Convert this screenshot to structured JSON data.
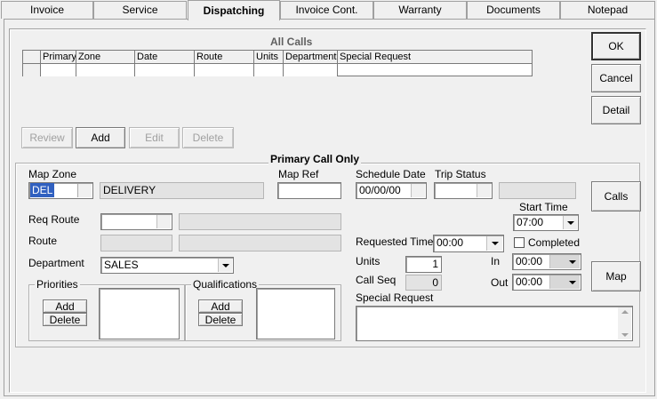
{
  "tabs": [
    "Invoice",
    "Service",
    "Dispatching",
    "Invoice Cont.",
    "Warranty",
    "Documents",
    "Notepad"
  ],
  "active_tab": "Dispatching",
  "all_calls": {
    "title": "All Calls",
    "columns": [
      "Primary",
      "Zone",
      "Date",
      "Route",
      "Units",
      "Department",
      "Special Request"
    ]
  },
  "call_buttons": {
    "review": "Review",
    "add": "Add",
    "edit": "Edit",
    "delete": "Delete"
  },
  "side_buttons": {
    "ok": "OK",
    "cancel": "Cancel",
    "detail": "Detail",
    "calls": "Calls",
    "map": "Map"
  },
  "primary": {
    "title": "Primary Call Only",
    "map_zone_label": "Map Zone",
    "map_zone_code": "DEL",
    "map_zone_desc": "DELIVERY",
    "map_ref_label": "Map Ref",
    "map_ref_value": "",
    "schedule_date_label": "Schedule Date",
    "schedule_date_value": "00/00/00",
    "trip_status_label": "Trip Status",
    "start_time_label": "Start Time",
    "start_time_value": "07:00",
    "req_route_label": "Req Route",
    "route_label": "Route",
    "department_label": "Department",
    "department_value": "SALES",
    "requested_time_label": "Requested Time",
    "requested_time_value": "00:00",
    "completed_label": "Completed",
    "units_label": "Units",
    "units_value": "1",
    "in_label": "In",
    "in_value": "00:00",
    "call_seq_label": "Call Seq",
    "call_seq_value": "0",
    "out_label": "Out",
    "out_value": "00:00",
    "special_request_label": "Special Request",
    "priorities_label": "Priorities",
    "qualifications_label": "Qualifications",
    "add_label": "Add",
    "delete_label": "Delete"
  }
}
